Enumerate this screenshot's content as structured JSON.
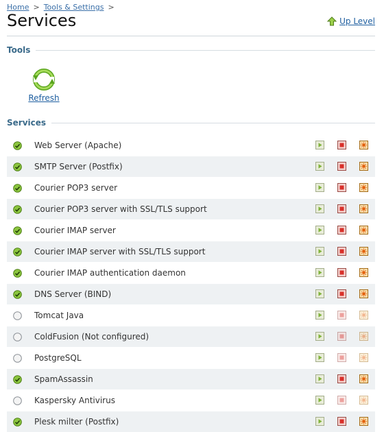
{
  "breadcrumb": {
    "items": [
      "Home",
      "Tools & Settings"
    ],
    "separator": ">"
  },
  "page": {
    "title": "Services",
    "up_level": "Up Level"
  },
  "tools": {
    "heading": "Tools",
    "refresh_label": "Refresh"
  },
  "services": {
    "heading": "Services",
    "items": [
      {
        "name": "Web Server (Apache)",
        "running": true
      },
      {
        "name": "SMTP Server (Postfix)",
        "running": true
      },
      {
        "name": "Courier POP3 server",
        "running": true
      },
      {
        "name": "Courier POP3 server with SSL/TLS support",
        "running": true
      },
      {
        "name": "Courier IMAP server",
        "running": true
      },
      {
        "name": "Courier IMAP server with SSL/TLS support",
        "running": true
      },
      {
        "name": "Courier IMAP authentication daemon",
        "running": true
      },
      {
        "name": "DNS Server (BIND)",
        "running": true
      },
      {
        "name": "Tomcat Java",
        "running": false
      },
      {
        "name": "ColdFusion (Not configured)",
        "running": false
      },
      {
        "name": "PostgreSQL",
        "running": false
      },
      {
        "name": "SpamAssassin",
        "running": true
      },
      {
        "name": "Kaspersky Antivirus",
        "running": false
      },
      {
        "name": "Plesk milter (Postfix)",
        "running": true
      }
    ]
  },
  "colors": {
    "link": "#1f5fa0",
    "section_heading": "#3a6a8a",
    "running_green": "#7bbf2a",
    "stop_red": "#d9302a",
    "restart_orange": "#f0a020"
  },
  "icons": {
    "up_level": "up-arrow-icon",
    "refresh": "refresh-arrows-icon",
    "running": "check-circle-icon",
    "stopped": "empty-circle-icon",
    "start": "play-icon",
    "stop": "stop-icon",
    "restart": "restart-gear-icon"
  }
}
